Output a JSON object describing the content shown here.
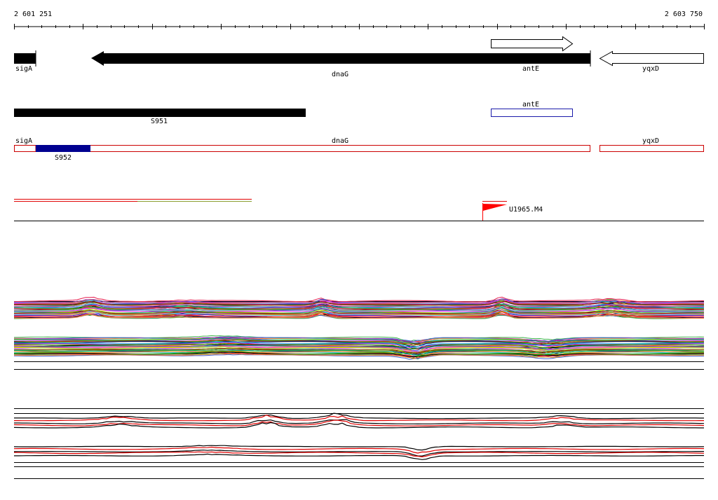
{
  "ruler": {
    "start_label": "2 601 251",
    "end_label": "2 603 750"
  },
  "genes": [
    {
      "name": "sigA",
      "label": "sigA",
      "strand": "-",
      "style": "filled"
    },
    {
      "name": "dnaG",
      "label": "dnaG",
      "strand": "-",
      "style": "filled"
    },
    {
      "name": "antE",
      "label": "antE",
      "strand": "+",
      "style": "outline"
    },
    {
      "name": "yqxD",
      "label": "yqxD",
      "strand": "-",
      "style": "outline"
    }
  ],
  "segments_track": {
    "s951": {
      "label": "S951"
    },
    "antE_box": {
      "label": "antE"
    }
  },
  "annotation_track": {
    "sigA": {
      "label": "sigA"
    },
    "dnaG": {
      "label": "dnaG"
    },
    "yqxD": {
      "label": "yqxD"
    },
    "s952": {
      "label": "S952"
    }
  },
  "marker": {
    "label": "U1965.M4"
  },
  "colors": {
    "gene_fill": "#000000",
    "outline_box": "#cc0000",
    "blue_box": "#1a1aaa",
    "segment_fill": "#000090",
    "marker": "#ff0000",
    "track_line": "#000000",
    "secondary_line": "#e00000"
  }
}
